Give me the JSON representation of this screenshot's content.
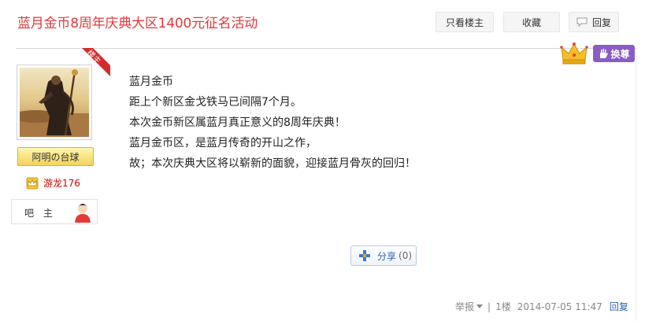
{
  "thread": {
    "title": "蓝月金币8周年庆典大区1400元征名活动"
  },
  "header_buttons": {
    "only_owner": "只看楼主",
    "favorite": "收藏",
    "reply": "回复"
  },
  "author": {
    "ribbon": "楼主",
    "name_tag": "阿明の台球",
    "level_name": "游龙176",
    "role": "吧 主",
    "badge_button": "换尊"
  },
  "post": {
    "lines": [
      "蓝月金币",
      "距上个新区金戈铁马已间隔7个月。",
      "本次金币新区属蓝月真正意义的8周年庆典！",
      "蓝月金币区，是蓝月传奇的开山之作，",
      "故；本次庆典大区将以崭新的面貌，迎接蓝月骨灰的回归！"
    ]
  },
  "share": {
    "label": "分享",
    "count": "(0)"
  },
  "footer": {
    "report": "举报",
    "separator": "|",
    "floor": "1楼",
    "datetime": "2014-07-05 11:47",
    "reply": "回复"
  },
  "colors": {
    "title_red": "#e4393c",
    "ribbon_red": "#d72b2b",
    "link_blue": "#2d64b3",
    "badge_purple": "#8b5cc4",
    "tag_gold": "#f3d35a"
  }
}
